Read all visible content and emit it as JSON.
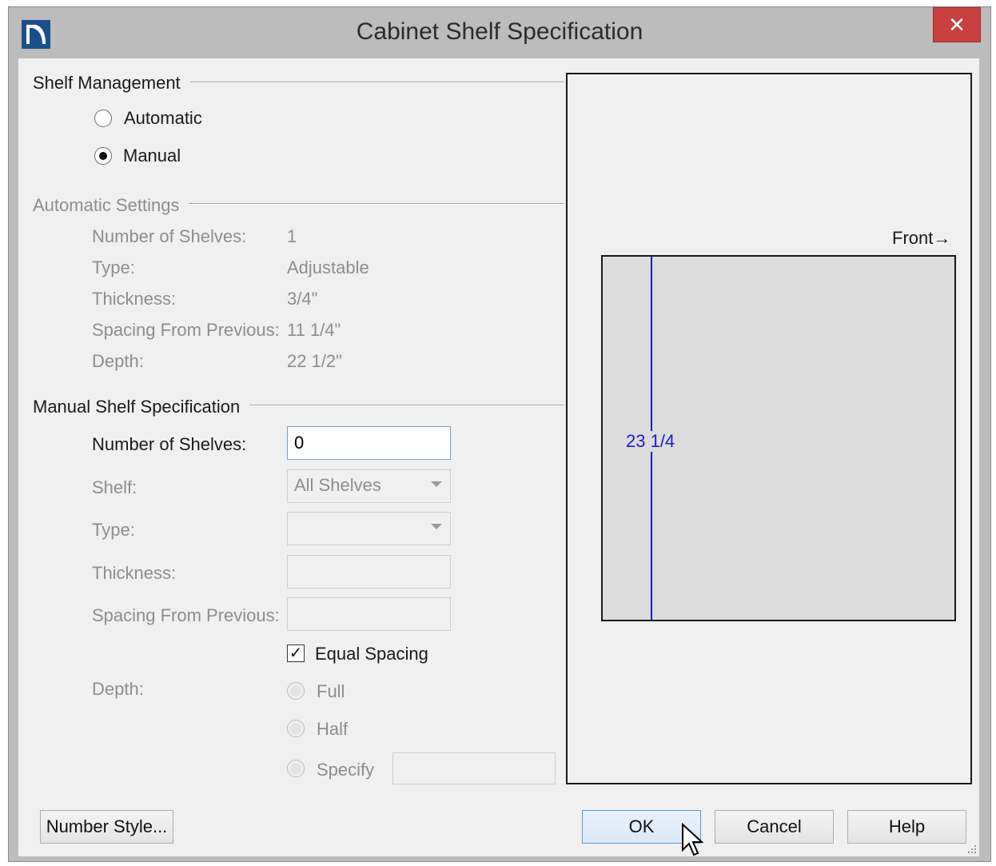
{
  "window": {
    "title": "Cabinet Shelf Specification",
    "close_label": "✕"
  },
  "shelf_management": {
    "title": "Shelf Management",
    "options": [
      {
        "label": "Automatic",
        "selected": false
      },
      {
        "label": "Manual",
        "selected": true
      }
    ]
  },
  "automatic_settings": {
    "title": "Automatic Settings",
    "rows": [
      {
        "label": "Number of Shelves:",
        "value": "1"
      },
      {
        "label": "Type:",
        "value": "Adjustable"
      },
      {
        "label": "Thickness:",
        "value": "3/4\""
      },
      {
        "label": "Spacing From Previous:",
        "value": "11 1/4\""
      },
      {
        "label": "Depth:",
        "value": "22 1/2\""
      }
    ]
  },
  "manual_spec": {
    "title": "Manual Shelf Specification",
    "number_of_shelves_label": "Number of Shelves:",
    "number_of_shelves_value": "0",
    "shelf_label": "Shelf:",
    "shelf_value": "All Shelves",
    "type_label": "Type:",
    "type_value": "",
    "thickness_label": "Thickness:",
    "thickness_value": "",
    "spacing_label": "Spacing From Previous:",
    "spacing_value": "",
    "equal_spacing_label": "Equal Spacing",
    "equal_spacing_checked": true,
    "depth_label": "Depth:",
    "depth_options": [
      "Full",
      "Half",
      "Specify"
    ],
    "specify_value": ""
  },
  "preview": {
    "front_label": "Front",
    "dimension_label": "23 1/4",
    "colors": {
      "dimension": "#1a1ad6",
      "cabinet_fill": "#dcdcdc"
    }
  },
  "buttons": {
    "number_style": "Number Style...",
    "ok": "OK",
    "cancel": "Cancel",
    "help": "Help"
  }
}
